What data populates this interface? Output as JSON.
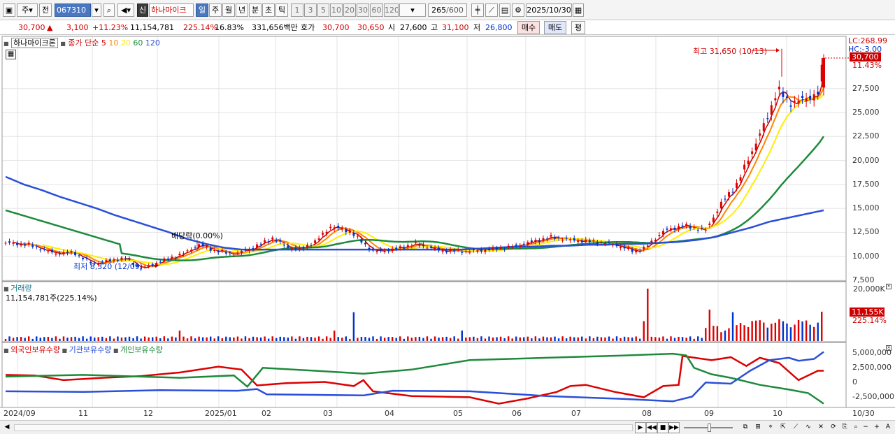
{
  "toolbar": {
    "type_label": "주",
    "prev_label": "전",
    "code": "067310",
    "shin_label": "신",
    "stock_name": "하나마이크",
    "periods": [
      "일",
      "주",
      "월",
      "년",
      "분",
      "초",
      "틱"
    ],
    "active_period": "일",
    "numbers": [
      "1",
      "3",
      "5",
      "10",
      "20",
      "30",
      "60",
      "120"
    ],
    "count": "265",
    "count_total": "/600",
    "date": "2025/10/30"
  },
  "info": {
    "price": "30,700",
    "change": "3,100",
    "change_pct": "+11.23%",
    "volume": "11,154,781",
    "vol_ratio": "225.14%",
    "turnover": "16.83%",
    "amount": "331,656백만",
    "hoga_label": "호가",
    "ask": "30,700",
    "bid": "30,650",
    "open_label": "시",
    "open": "27,600",
    "high_label": "고",
    "high": "31,100",
    "low_label": "저",
    "low": "26,800",
    "buy_label": "매수",
    "sell_label": "매도",
    "avg_label": "평"
  },
  "price_panel": {
    "name": "하나마이크론",
    "legend_label": "종가 단순",
    "ma_periods": [
      "5",
      "10",
      "20",
      "60",
      "120"
    ],
    "ma_colors": [
      "#cc0000",
      "#ff8800",
      "#ffee00",
      "#1e8a3c",
      "#2a4fd8"
    ],
    "lc": "LC:268.99",
    "hc": "HC:-3.00",
    "current_price": "30,700",
    "current_pct": "11.43%",
    "high_note": "최고 31,650 (10/13)",
    "low_note": "최저 8,320 (12/09)",
    "dividend_note": "배당락(0.00%)",
    "y_ticks": [
      "27,500",
      "25,000",
      "22,500",
      "20,000",
      "17,500",
      "15,000",
      "12,500",
      "10,000",
      "7,500"
    ]
  },
  "volume_panel": {
    "title": "거래량",
    "value": "11,154,781주(225.14%)",
    "y_top": "20,000K",
    "current": "11,155K",
    "current_pct": "225.14%"
  },
  "holdings_panel": {
    "series": [
      "외국인보유수량",
      "기관보유수량",
      "개인보유수량"
    ],
    "series_colors": [
      "#dd0000",
      "#2a4fd8",
      "#1e8a3c"
    ],
    "y_ticks": [
      "5,000,000",
      "2,500,000",
      "0",
      "-2,500,000"
    ]
  },
  "x_axis": [
    "2024/09",
    "11",
    "12",
    "2025/01",
    "02",
    "03",
    "04",
    "05",
    "06",
    "07",
    "08",
    "09",
    "10",
    "10/30"
  ],
  "chart_data": [
    {
      "type": "candlestick",
      "title": "하나마이크론",
      "ylim": [
        7500,
        32000
      ],
      "series": [
        {
          "name": "5",
          "values": [
            11400,
            11200,
            10300,
            10400,
            9200,
            9600,
            9800,
            8700,
            9600,
            10300,
            11200,
            10600,
            10200,
            10900,
            11900,
            11000,
            10700,
            11500,
            13100,
            12600,
            10500,
            10700,
            11300,
            10600,
            10500,
            10700,
            11000,
            11500,
            12000,
            11700,
            11500,
            11200,
            10500,
            10800,
            12600,
            13200,
            12900,
            12700,
            15500,
            17500,
            21000,
            24500,
            27500,
            26000,
            26300,
            27000,
            30700
          ]
        },
        {
          "name": "120",
          "values": [
            18300,
            17500,
            16900,
            16200,
            15600,
            15000,
            14300,
            13700,
            13100,
            12500,
            11800,
            11300,
            10900,
            10700,
            10700,
            10700,
            10700,
            10700,
            10700,
            10700,
            10700,
            10700,
            10700,
            10700,
            10700,
            10700,
            10800,
            10900,
            11000,
            11000,
            11100,
            11100,
            11200,
            11200,
            11300,
            11300,
            11400,
            11500,
            11700,
            12000,
            12500,
            13000,
            13600,
            14000,
            14400,
            14800
          ]
        }
      ],
      "high": 31650,
      "low": 8320
    }
  ]
}
